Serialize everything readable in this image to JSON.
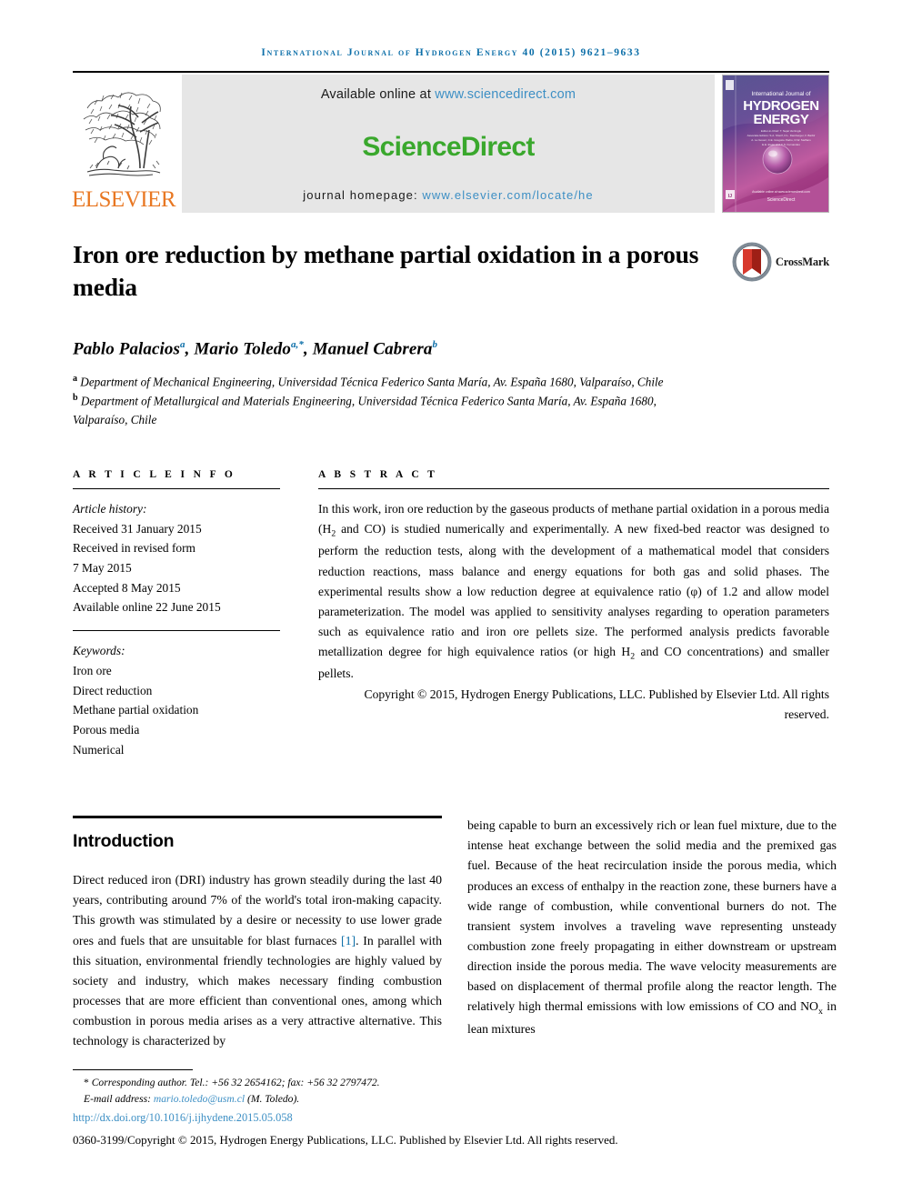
{
  "running_head": "International Journal of Hydrogen Energy 40 (2015) 9621–9633",
  "masthead": {
    "publisher_name": "ELSEVIER",
    "available_prefix": "Available online at",
    "sciencedirect_url": "www.sciencedirect.com",
    "sciencedirect_wordmark": "ScienceDirect",
    "homepage_label": "journal homepage:",
    "homepage_url": "www.elsevier.com/locate/he",
    "cover": {
      "line1": "International Journal of",
      "line2": "HYDROGEN",
      "line3": "ENERGY",
      "editor_block": "Editor-in-Chief: T. Nejat Veziroğlu\nAssociate Editors: S. A. Sherif, D. L. Damberger, F. Barbir, A. Le Gouez, C. E. Grégoire Padró, D. W. Steffans, E. E. Ewan and C. S. Fernandes",
      "footer_mark": "ScienceDirect"
    }
  },
  "article": {
    "title": "Iron ore reduction by methane partial oxidation in a porous media",
    "crossmark_label": "CrossMark",
    "authors": [
      {
        "name": "Pablo Palacios",
        "marks": "a"
      },
      {
        "name": "Mario Toledo",
        "marks": "a,*"
      },
      {
        "name": "Manuel Cabrera",
        "marks": "b"
      }
    ],
    "authors_line": "Pablo Palacios , Mario Toledo , Manuel Cabrera",
    "affiliations": [
      {
        "mark": "a",
        "text": "Department of Mechanical Engineering, Universidad Técnica Federico Santa María, Av. España 1680, Valparaíso, Chile"
      },
      {
        "mark": "b",
        "text": "Department of Metallurgical and Materials Engineering, Universidad Técnica Federico Santa María, Av. España 1680, Valparaíso, Chile"
      }
    ]
  },
  "article_info": {
    "heading": "A R T I C L E  I N F O",
    "history_label": "Article history:",
    "history": [
      "Received 31 January 2015",
      "Received in revised form",
      "7 May 2015",
      "Accepted 8 May 2015",
      "Available online 22 June 2015"
    ],
    "keywords_label": "Keywords:",
    "keywords": [
      "Iron ore",
      "Direct reduction",
      "Methane partial oxidation",
      "Porous media",
      "Numerical"
    ]
  },
  "abstract": {
    "heading": "A B S T R A C T",
    "paragraph_1": "In this work, iron ore reduction by the gaseous products of methane partial oxidation in a porous media (H",
    "paragraph_1_sub": "2",
    "paragraph_1b": " and CO) is studied numerically and experimentally. A new fixed-bed reactor was designed to perform the reduction tests, along with the development of a mathematical model that considers reduction reactions, mass balance and energy equations for both gas and solid phases. The experimental results show a low reduction degree at equivalence ratio (φ) of 1.2 and allow model parameterization. The model was applied to sensitivity analyses regarding to operation parameters such as equivalence ratio and iron ore pellets size. The performed analysis predicts favorable metallization degree for high equivalence ratios (or high H",
    "paragraph_1c": " and CO concentrations) and smaller pellets.",
    "copyright": "Copyright © 2015, Hydrogen Energy Publications, LLC. Published by Elsevier Ltd. All rights reserved."
  },
  "introduction": {
    "heading": "Introduction",
    "left_part_a": "Direct reduced iron (DRI) industry has grown steadily during the last 40 years, contributing around 7% of the world's total iron-making capacity. This growth was stimulated by a desire or necessity to use lower grade ores and fuels that are unsuitable for blast furnaces ",
    "left_reference": "[1]",
    "left_part_b": ". In parallel with this situation, environmental friendly technologies are highly valued by society and industry, which makes necessary finding combustion processes that are more efficient than conventional ones, among which combustion in porous media arises as a very attractive alternative. This technology is characterized by",
    "right_part_a": "being capable to burn an excessively rich or lean fuel mixture, due to the intense heat exchange between the solid media and the premixed gas fuel. Because of the heat recirculation inside the porous media, which produces an excess of enthalpy in the reaction zone, these burners have a wide range of combustion, while conventional burners do not. The transient system involves a traveling wave representing unsteady combustion zone freely propagating in either downstream or upstream direction inside the porous media. The wave velocity measurements are based on displacement of thermal profile along the reactor length. The relatively high thermal emissions with low emissions of CO and NO",
    "right_sub": "x",
    "right_part_b": " in lean mixtures"
  },
  "footnotes": {
    "corresponding_star": "*",
    "corresponding_text": "Corresponding author. Tel.: +56 32 2654162; fax: +56 32 2797472.",
    "email_label": "E-mail address:",
    "email": "mario.toledo@usm.cl",
    "email_suffix": "(M. Toledo).",
    "doi": "http://dx.doi.org/10.1016/j.ijhydene.2015.05.058",
    "issn_copyright": "0360-3199/Copyright © 2015, Hydrogen Energy Publications, LLC. Published by Elsevier Ltd. All rights reserved."
  },
  "colors": {
    "journal_blue": "#0b6ea8",
    "link_blue": "#3d8fc4",
    "sciencedirect_green": "#3aa82d",
    "elsevier_orange": "#e87722",
    "crossmark_red": "#c3281e",
    "banner_gray": "#e6e6e6"
  }
}
